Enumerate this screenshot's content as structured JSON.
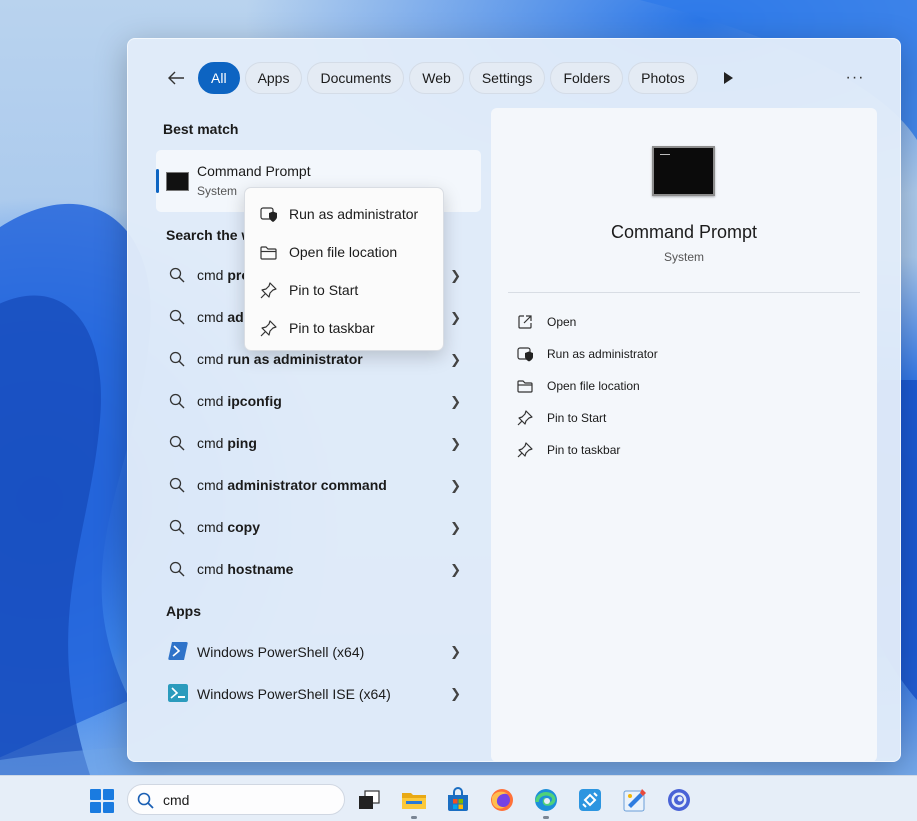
{
  "filters": {
    "back_label": "←",
    "items": [
      {
        "label": "All",
        "active": true
      },
      {
        "label": "Apps"
      },
      {
        "label": "Documents"
      },
      {
        "label": "Web"
      },
      {
        "label": "Settings"
      },
      {
        "label": "Folders"
      },
      {
        "label": "Photos"
      }
    ],
    "more_label": "···"
  },
  "best_match": {
    "section_title": "Best match",
    "name": "Command Prompt",
    "type": "System"
  },
  "search_web": {
    "section_title": "Search the w",
    "items": [
      {
        "prefix": "cmd ",
        "bold": "pro"
      },
      {
        "prefix": "cmd ",
        "bold": "ad"
      },
      {
        "prefix": "cmd ",
        "bold": "run as administrator"
      },
      {
        "prefix": "cmd ",
        "bold": "ipconfig"
      },
      {
        "prefix": "cmd ",
        "bold": "ping"
      },
      {
        "prefix": "cmd ",
        "bold": "administrator command"
      },
      {
        "prefix": "cmd ",
        "bold": "copy"
      },
      {
        "prefix": "cmd ",
        "bold": "hostname"
      }
    ]
  },
  "apps": {
    "section_title": "Apps",
    "items": [
      {
        "name": "Windows PowerShell (x64)"
      },
      {
        "name": "Windows PowerShell ISE (x64)"
      }
    ]
  },
  "context_menu": {
    "items": [
      {
        "label": "Run as administrator",
        "icon": "shield-icon"
      },
      {
        "label": "Open file location",
        "icon": "folder-icon"
      },
      {
        "label": "Pin to Start",
        "icon": "pin-icon"
      },
      {
        "label": "Pin to taskbar",
        "icon": "pin-icon"
      }
    ]
  },
  "detail": {
    "title": "Command Prompt",
    "subtitle": "System",
    "actions": [
      {
        "label": "Open",
        "icon": "open-external-icon"
      },
      {
        "label": "Run as administrator",
        "icon": "shield-icon"
      },
      {
        "label": "Open file location",
        "icon": "folder-icon"
      },
      {
        "label": "Pin to Start",
        "icon": "pin-icon"
      },
      {
        "label": "Pin to taskbar",
        "icon": "pin-icon"
      }
    ]
  },
  "taskbar": {
    "search_value": "cmd",
    "apps": [
      "task-view-icon",
      "file-explorer-icon",
      "microsoft-store-icon",
      "firefox-icon",
      "edge-icon",
      "remote-desktop-icon",
      "paint-icon",
      "browser-icon"
    ]
  },
  "colors": {
    "accent": "#0d64c2",
    "panel": "#e2ecf9"
  }
}
